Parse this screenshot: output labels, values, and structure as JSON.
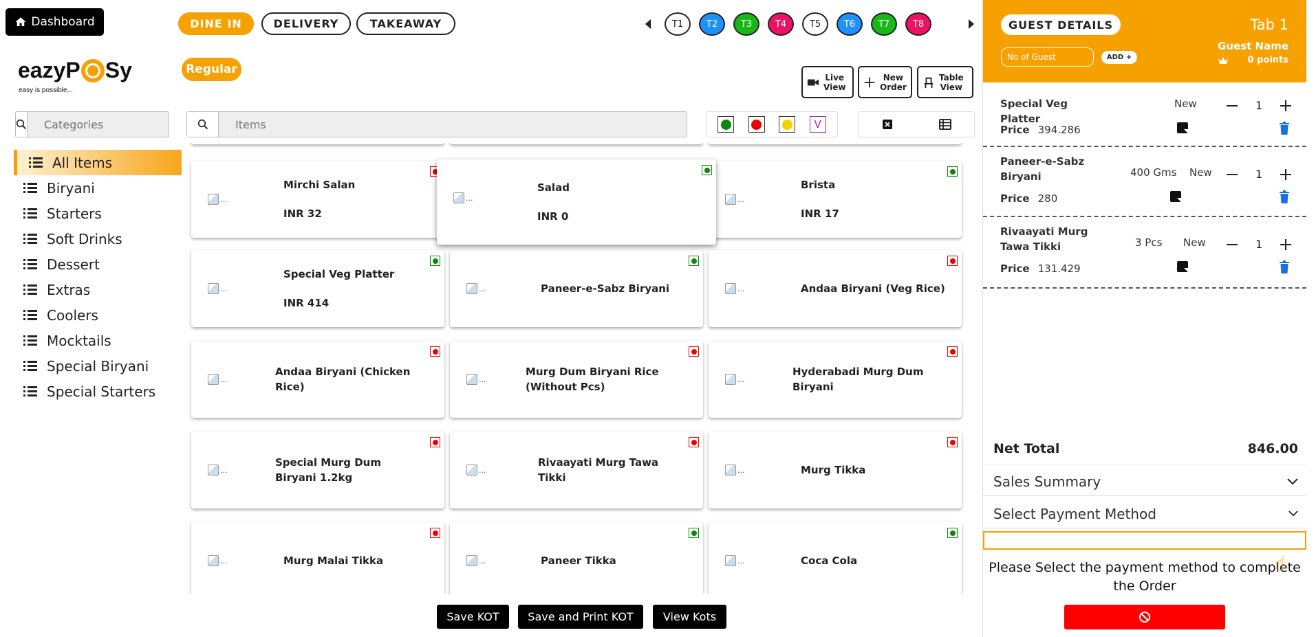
{
  "header": {
    "dashboard_label": "Dashboard",
    "order_types": [
      {
        "label": "DINE IN",
        "active": true
      },
      {
        "label": "DELIVERY",
        "active": false
      },
      {
        "label": "TAKEAWAY",
        "active": false
      }
    ],
    "price_list": "Regular",
    "tables": [
      {
        "label": "T1",
        "color": "#ffffff",
        "text_color": "#222222"
      },
      {
        "label": "T2",
        "color": "#1e90ff",
        "text_color": "#ffffff"
      },
      {
        "label": "T3",
        "color": "#17b817",
        "text_color": "#ffffff"
      },
      {
        "label": "T4",
        "color": "#ee1166",
        "text_color": "#ffffff"
      },
      {
        "label": "T5",
        "color": "#ffffff",
        "text_color": "#222222"
      },
      {
        "label": "T6",
        "color": "#1e90ff",
        "text_color": "#ffffff"
      },
      {
        "label": "T7",
        "color": "#17b817",
        "text_color": "#ffffff"
      },
      {
        "label": "T8",
        "color": "#ee1166",
        "text_color": "#ffffff"
      }
    ],
    "actions": {
      "live_view": [
        "Live",
        "View"
      ],
      "new_order": [
        "New",
        "Order"
      ],
      "table_view": [
        "Table",
        "View"
      ]
    }
  },
  "logo": {
    "text_a": "eazyP",
    "text_b": "Sy",
    "tagline": "easy is possible..."
  },
  "categories": {
    "search_placeholder": "Categories",
    "items": [
      {
        "label": "All Items",
        "active": true
      },
      {
        "label": "Biryani",
        "active": false
      },
      {
        "label": "Starters",
        "active": false
      },
      {
        "label": "Soft Drinks",
        "active": false
      },
      {
        "label": "Dessert",
        "active": false
      },
      {
        "label": "Extras",
        "active": false
      },
      {
        "label": "Coolers",
        "active": false
      },
      {
        "label": "Mocktails",
        "active": false
      },
      {
        "label": "Special Biryani",
        "active": false
      },
      {
        "label": "Special Starters",
        "active": false
      }
    ]
  },
  "items_search": {
    "placeholder": "Items"
  },
  "filters": {
    "veg_color": "#0a8a0a",
    "nonveg_color": "#ee0000",
    "egg_color": "#f6d000",
    "vegan_label": "V"
  },
  "items": [
    {
      "name": "Mirchi Salan",
      "price": "INR 32",
      "type": "nonveg"
    },
    {
      "name": "Salad",
      "price": "INR 0",
      "type": "veg"
    },
    {
      "name": "Brista",
      "price": "INR 17",
      "type": "veg"
    },
    {
      "name": "Special Veg Platter",
      "price": "INR 414",
      "type": "veg"
    },
    {
      "name": "Paneer-e-Sabz Biryani",
      "price": "",
      "type": "veg"
    },
    {
      "name": "Andaa Biryani (Veg Rice)",
      "price": "",
      "type": "nonveg"
    },
    {
      "name": "Andaa Biryani (Chicken Rice)",
      "price": "",
      "type": "nonveg"
    },
    {
      "name": "Murg Dum Biryani Rice (Without Pcs)",
      "price": "",
      "type": "nonveg"
    },
    {
      "name": "Hyderabadi Murg Dum Biryani",
      "price": "",
      "type": "nonveg"
    },
    {
      "name": "Special Murg Dum Biryani 1.2kg",
      "price": "",
      "type": "nonveg"
    },
    {
      "name": "Rivaayati Murg Tawa Tikki",
      "price": "",
      "type": "nonveg"
    },
    {
      "name": "Murg Tikka",
      "price": "",
      "type": "nonveg"
    },
    {
      "name": "Murg Malai Tikka",
      "price": "",
      "type": "nonveg"
    },
    {
      "name": "Paneer Tikka",
      "price": "",
      "type": "veg"
    },
    {
      "name": "Coca Cola",
      "price": "",
      "type": "veg"
    }
  ],
  "image_alt": "...",
  "bottom_actions": {
    "save_kot": "Save KOT",
    "save_print_kot": "Save and Print KOT",
    "view_kots": "View Kots"
  },
  "order_panel": {
    "guest_details_label": "GUEST DETAILS",
    "tab_title": "Tab 1",
    "guest_input_placeholder": "No of Guest",
    "add_label": "ADD +",
    "guest_name": "Guest Name",
    "points": "0 points",
    "price_label": "Price",
    "lines": [
      {
        "name": "Special Veg Platter",
        "qty_desc": "",
        "status": "New",
        "count": "1",
        "price": "394.286"
      },
      {
        "name": "Paneer-e-Sabz Biryani",
        "qty_desc": "400 Gms",
        "status": "New",
        "count": "1",
        "price": "280"
      },
      {
        "name": "Rivaayati Murg Tawa Tikki",
        "qty_desc": "3 Pcs",
        "status": "New",
        "count": "1",
        "price": "131.429"
      }
    ],
    "net_total_label": "Net Total",
    "net_total": "846.00",
    "sales_summary": "Sales Summary",
    "payment_method": "Select Payment Method",
    "payment_message": "Please Select the payment method to complete the Order"
  }
}
